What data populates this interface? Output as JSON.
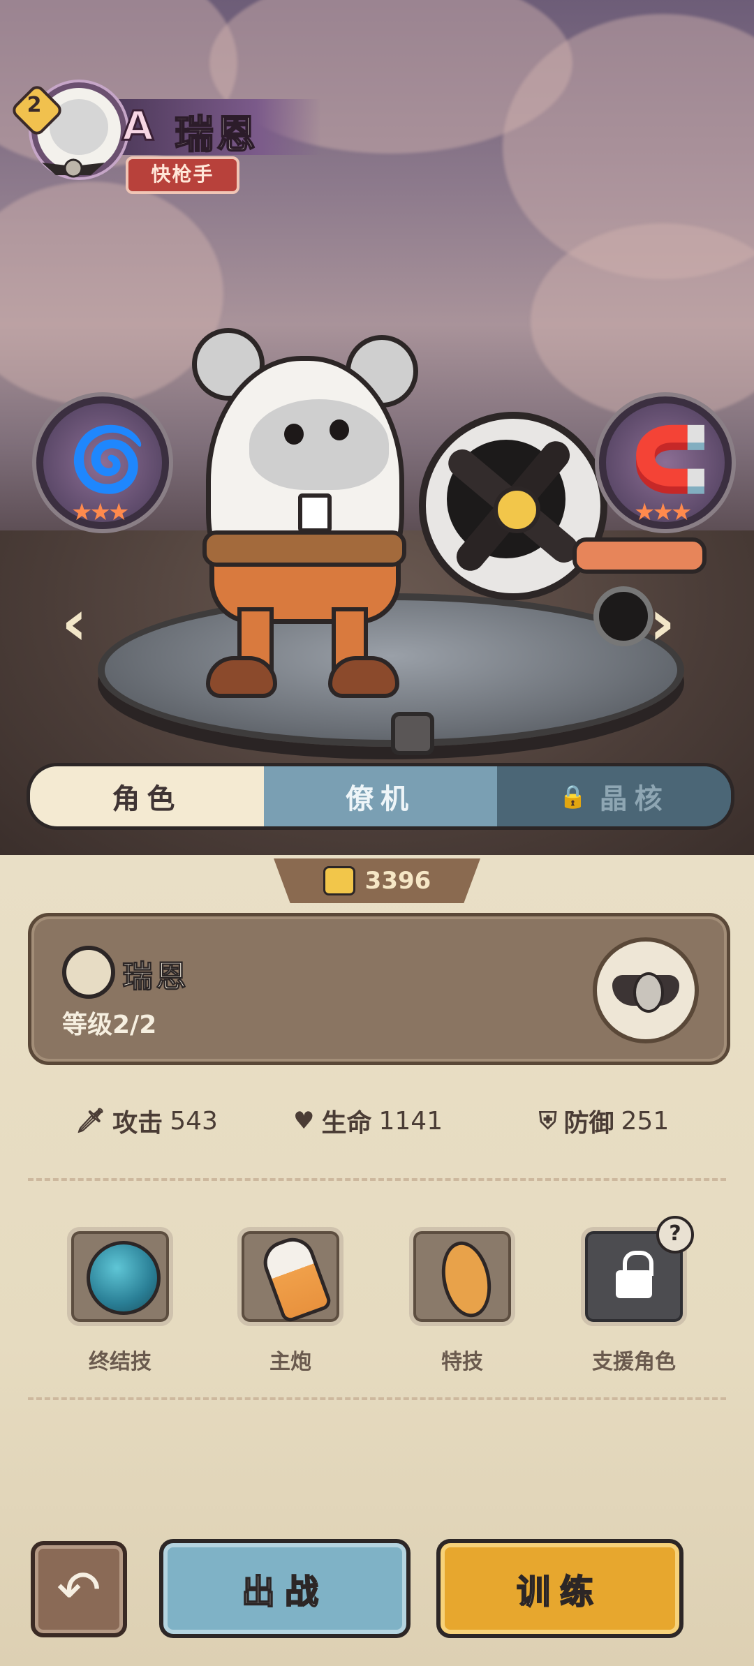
{
  "header": {
    "level": "2",
    "rank": "A",
    "name": "瑞恩",
    "role": "快枪手"
  },
  "nav": {
    "prev": "‹",
    "next": "›"
  },
  "tabs": [
    {
      "label": "角色"
    },
    {
      "label": "僚机"
    },
    {
      "label": "晶核"
    }
  ],
  "currency": {
    "amount": "3396"
  },
  "info": {
    "name": "瑞恩",
    "level": "等级2/2"
  },
  "stats": {
    "attack_label": "攻击",
    "attack_value": "543",
    "hp_label": "生命",
    "hp_value": "1141",
    "defense_label": "防御",
    "defense_value": "251"
  },
  "skills": [
    {
      "label": "终结技"
    },
    {
      "label": "主炮"
    },
    {
      "label": "特技"
    },
    {
      "label": "支援角色"
    }
  ],
  "help": "?",
  "buttons": {
    "back_icon": "↶",
    "fight": "出战",
    "train": "训练"
  },
  "colors": {
    "accent_blue": "#7fb2c6",
    "accent_orange": "#e7a72e",
    "role_red": "#b8413b",
    "panel_brown": "#8a7562"
  }
}
